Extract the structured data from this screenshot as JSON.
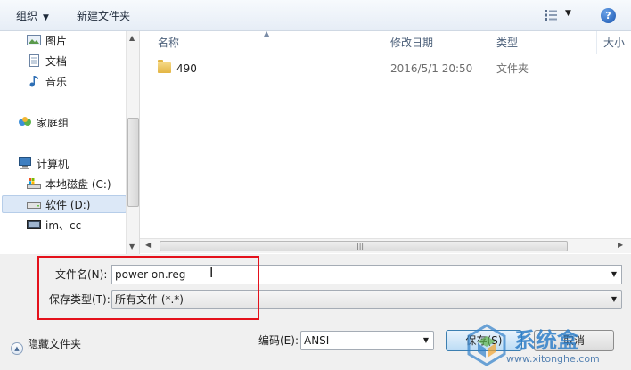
{
  "toolbar": {
    "organize_label": "组织",
    "new_folder_label": "新建文件夹",
    "view_icon": "list-view-icon",
    "help_icon": "help-icon"
  },
  "nav": {
    "items": [
      {
        "label": "图片",
        "icon": "pictures-icon"
      },
      {
        "label": "文档",
        "icon": "documents-icon"
      },
      {
        "label": "音乐",
        "icon": "music-icon"
      },
      {
        "label": "家庭组",
        "icon": "homegroup-icon"
      },
      {
        "label": "计算机",
        "icon": "computer-icon"
      },
      {
        "label": "本地磁盘 (C:)",
        "icon": "local-disk-icon"
      },
      {
        "label": "软件 (D:)",
        "icon": "drive-icon"
      },
      {
        "label": "im、cc",
        "icon": "drive-icon"
      }
    ]
  },
  "content": {
    "columns": [
      "名称",
      "修改日期",
      "类型",
      "大小"
    ],
    "rows": [
      {
        "name": "490",
        "modified": "2016/5/1 20:50",
        "type": "文件夹"
      }
    ]
  },
  "form": {
    "filename_label": "文件名(N):",
    "filename_value": "power on.reg",
    "filetype_label": "保存类型(T):",
    "filetype_value": "所有文件 (*.*)",
    "encoding_label": "编码(E):",
    "encoding_value": "ANSI"
  },
  "buttons": {
    "save": "保存(S)",
    "cancel": "取消",
    "hide_folders": "隐藏文件夹"
  },
  "watermark": {
    "brand": "系统盒",
    "url": "www.xitonghe.com"
  },
  "colors": {
    "highlight_border": "#e4111b",
    "selection": "#dce8f7",
    "watermark": "#2f7fc9"
  }
}
